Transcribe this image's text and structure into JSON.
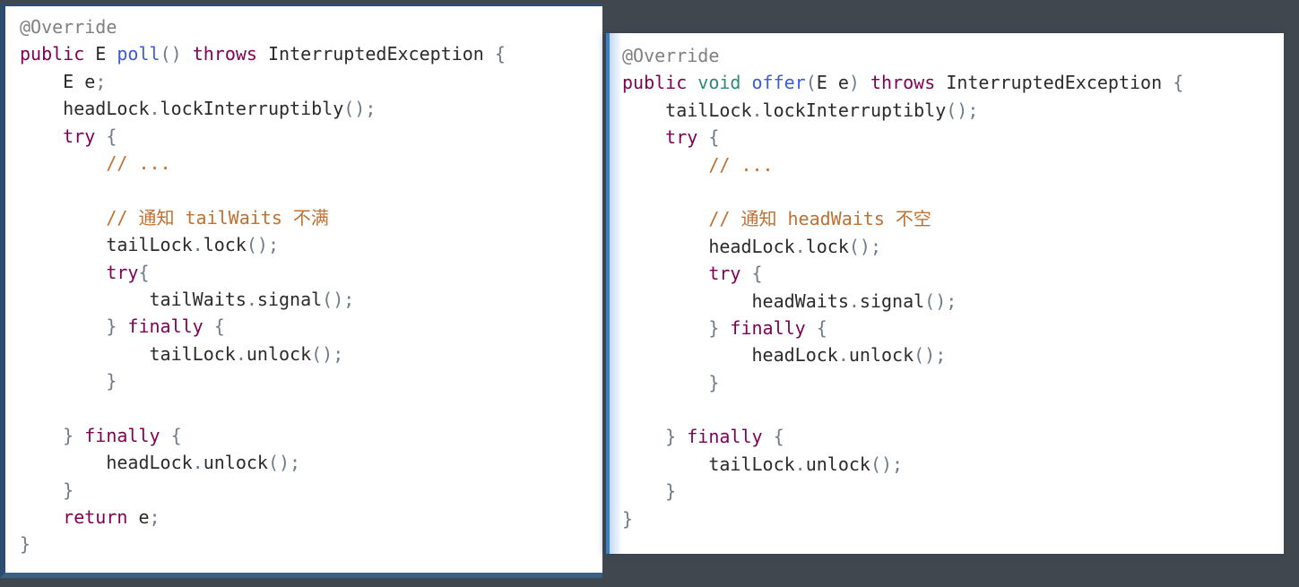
{
  "colors": {
    "background": "#41474f",
    "card_background": "#ffffff",
    "left_card_border": "#2e4d6e",
    "right_card_border": "#3d7fc1",
    "annotation": "#808080",
    "keyword": "#7f0055",
    "primitive_type": "#2c8a78",
    "function_name": "#3b5bdb",
    "comment": "#c07030",
    "punctuation": "#6e7b8b",
    "plain_text": "#2b2b2b"
  },
  "left_panel": {
    "title": "poll-method-snippet",
    "language": "java",
    "lines": [
      [
        {
          "t": "@Override",
          "c": "ann"
        }
      ],
      [
        {
          "t": "public",
          "c": "kw"
        },
        {
          "t": " ",
          "c": "plain"
        },
        {
          "t": "E",
          "c": "type"
        },
        {
          "t": " ",
          "c": "plain"
        },
        {
          "t": "poll",
          "c": "fn"
        },
        {
          "t": "()",
          "c": "punc"
        },
        {
          "t": " ",
          "c": "plain"
        },
        {
          "t": "throws",
          "c": "kw"
        },
        {
          "t": " ",
          "c": "plain"
        },
        {
          "t": "InterruptedException",
          "c": "type"
        },
        {
          "t": " ",
          "c": "plain"
        },
        {
          "t": "{",
          "c": "punc"
        }
      ],
      [
        {
          "t": "    ",
          "c": "plain"
        },
        {
          "t": "E",
          "c": "type"
        },
        {
          "t": " e",
          "c": "plain"
        },
        {
          "t": ";",
          "c": "punc"
        }
      ],
      [
        {
          "t": "    headLock",
          "c": "plain"
        },
        {
          "t": ".",
          "c": "punc"
        },
        {
          "t": "lockInterruptibly",
          "c": "plain"
        },
        {
          "t": "();",
          "c": "punc"
        }
      ],
      [
        {
          "t": "    ",
          "c": "plain"
        },
        {
          "t": "try",
          "c": "kw"
        },
        {
          "t": " ",
          "c": "plain"
        },
        {
          "t": "{",
          "c": "punc"
        }
      ],
      [
        {
          "t": "        ",
          "c": "plain"
        },
        {
          "t": "// ...",
          "c": "cmt"
        }
      ],
      [
        {
          "t": "",
          "c": "plain"
        }
      ],
      [
        {
          "t": "        ",
          "c": "plain"
        },
        {
          "t": "// 通知 tailWaits 不满",
          "c": "cmt"
        }
      ],
      [
        {
          "t": "        tailLock",
          "c": "plain"
        },
        {
          "t": ".",
          "c": "punc"
        },
        {
          "t": "lock",
          "c": "plain"
        },
        {
          "t": "();",
          "c": "punc"
        }
      ],
      [
        {
          "t": "        ",
          "c": "plain"
        },
        {
          "t": "try",
          "c": "kw"
        },
        {
          "t": "{",
          "c": "punc"
        }
      ],
      [
        {
          "t": "            tailWaits",
          "c": "plain"
        },
        {
          "t": ".",
          "c": "punc"
        },
        {
          "t": "signal",
          "c": "plain"
        },
        {
          "t": "();",
          "c": "punc"
        }
      ],
      [
        {
          "t": "        ",
          "c": "plain"
        },
        {
          "t": "}",
          "c": "punc"
        },
        {
          "t": " ",
          "c": "plain"
        },
        {
          "t": "finally",
          "c": "kw"
        },
        {
          "t": " ",
          "c": "plain"
        },
        {
          "t": "{",
          "c": "punc"
        }
      ],
      [
        {
          "t": "            tailLock",
          "c": "plain"
        },
        {
          "t": ".",
          "c": "punc"
        },
        {
          "t": "unlock",
          "c": "plain"
        },
        {
          "t": "();",
          "c": "punc"
        }
      ],
      [
        {
          "t": "        ",
          "c": "plain"
        },
        {
          "t": "}",
          "c": "punc"
        }
      ],
      [
        {
          "t": "",
          "c": "plain"
        }
      ],
      [
        {
          "t": "    ",
          "c": "plain"
        },
        {
          "t": "}",
          "c": "punc"
        },
        {
          "t": " ",
          "c": "plain"
        },
        {
          "t": "finally",
          "c": "kw"
        },
        {
          "t": " ",
          "c": "plain"
        },
        {
          "t": "{",
          "c": "punc"
        }
      ],
      [
        {
          "t": "        headLock",
          "c": "plain"
        },
        {
          "t": ".",
          "c": "punc"
        },
        {
          "t": "unlock",
          "c": "plain"
        },
        {
          "t": "();",
          "c": "punc"
        }
      ],
      [
        {
          "t": "    ",
          "c": "plain"
        },
        {
          "t": "}",
          "c": "punc"
        }
      ],
      [
        {
          "t": "    ",
          "c": "plain"
        },
        {
          "t": "return",
          "c": "kw"
        },
        {
          "t": " e",
          "c": "plain"
        },
        {
          "t": ";",
          "c": "punc"
        }
      ],
      [
        {
          "t": "}",
          "c": "punc"
        }
      ]
    ]
  },
  "right_panel": {
    "title": "offer-method-snippet",
    "language": "java",
    "lines": [
      [
        {
          "t": "@Override",
          "c": "ann"
        }
      ],
      [
        {
          "t": "public",
          "c": "kw"
        },
        {
          "t": " ",
          "c": "plain"
        },
        {
          "t": "void",
          "c": "prim"
        },
        {
          "t": " ",
          "c": "plain"
        },
        {
          "t": "offer",
          "c": "fn"
        },
        {
          "t": "(",
          "c": "punc"
        },
        {
          "t": "E",
          "c": "type"
        },
        {
          "t": " e",
          "c": "plain"
        },
        {
          "t": ")",
          "c": "punc"
        },
        {
          "t": " ",
          "c": "plain"
        },
        {
          "t": "throws",
          "c": "kw"
        },
        {
          "t": " ",
          "c": "plain"
        },
        {
          "t": "InterruptedException",
          "c": "type"
        },
        {
          "t": " ",
          "c": "plain"
        },
        {
          "t": "{",
          "c": "punc"
        }
      ],
      [
        {
          "t": "    tailLock",
          "c": "plain"
        },
        {
          "t": ".",
          "c": "punc"
        },
        {
          "t": "lockInterruptibly",
          "c": "plain"
        },
        {
          "t": "();",
          "c": "punc"
        }
      ],
      [
        {
          "t": "    ",
          "c": "plain"
        },
        {
          "t": "try",
          "c": "kw"
        },
        {
          "t": " ",
          "c": "plain"
        },
        {
          "t": "{",
          "c": "punc"
        }
      ],
      [
        {
          "t": "        ",
          "c": "plain"
        },
        {
          "t": "// ...",
          "c": "cmt"
        }
      ],
      [
        {
          "t": "",
          "c": "plain"
        }
      ],
      [
        {
          "t": "        ",
          "c": "plain"
        },
        {
          "t": "// 通知 headWaits 不空",
          "c": "cmt"
        }
      ],
      [
        {
          "t": "        headLock",
          "c": "plain"
        },
        {
          "t": ".",
          "c": "punc"
        },
        {
          "t": "lock",
          "c": "plain"
        },
        {
          "t": "();",
          "c": "punc"
        }
      ],
      [
        {
          "t": "        ",
          "c": "plain"
        },
        {
          "t": "try",
          "c": "kw"
        },
        {
          "t": " ",
          "c": "plain"
        },
        {
          "t": "{",
          "c": "punc"
        }
      ],
      [
        {
          "t": "            headWaits",
          "c": "plain"
        },
        {
          "t": ".",
          "c": "punc"
        },
        {
          "t": "signal",
          "c": "plain"
        },
        {
          "t": "();",
          "c": "punc"
        }
      ],
      [
        {
          "t": "        ",
          "c": "plain"
        },
        {
          "t": "}",
          "c": "punc"
        },
        {
          "t": " ",
          "c": "plain"
        },
        {
          "t": "finally",
          "c": "kw"
        },
        {
          "t": " ",
          "c": "plain"
        },
        {
          "t": "{",
          "c": "punc"
        }
      ],
      [
        {
          "t": "            headLock",
          "c": "plain"
        },
        {
          "t": ".",
          "c": "punc"
        },
        {
          "t": "unlock",
          "c": "plain"
        },
        {
          "t": "();",
          "c": "punc"
        }
      ],
      [
        {
          "t": "        ",
          "c": "plain"
        },
        {
          "t": "}",
          "c": "punc"
        }
      ],
      [
        {
          "t": "",
          "c": "plain"
        }
      ],
      [
        {
          "t": "    ",
          "c": "plain"
        },
        {
          "t": "}",
          "c": "punc"
        },
        {
          "t": " ",
          "c": "plain"
        },
        {
          "t": "finally",
          "c": "kw"
        },
        {
          "t": " ",
          "c": "plain"
        },
        {
          "t": "{",
          "c": "punc"
        }
      ],
      [
        {
          "t": "        tailLock",
          "c": "plain"
        },
        {
          "t": ".",
          "c": "punc"
        },
        {
          "t": "unlock",
          "c": "plain"
        },
        {
          "t": "();",
          "c": "punc"
        }
      ],
      [
        {
          "t": "    ",
          "c": "plain"
        },
        {
          "t": "}",
          "c": "punc"
        }
      ],
      [
        {
          "t": "}",
          "c": "punc"
        }
      ]
    ]
  }
}
